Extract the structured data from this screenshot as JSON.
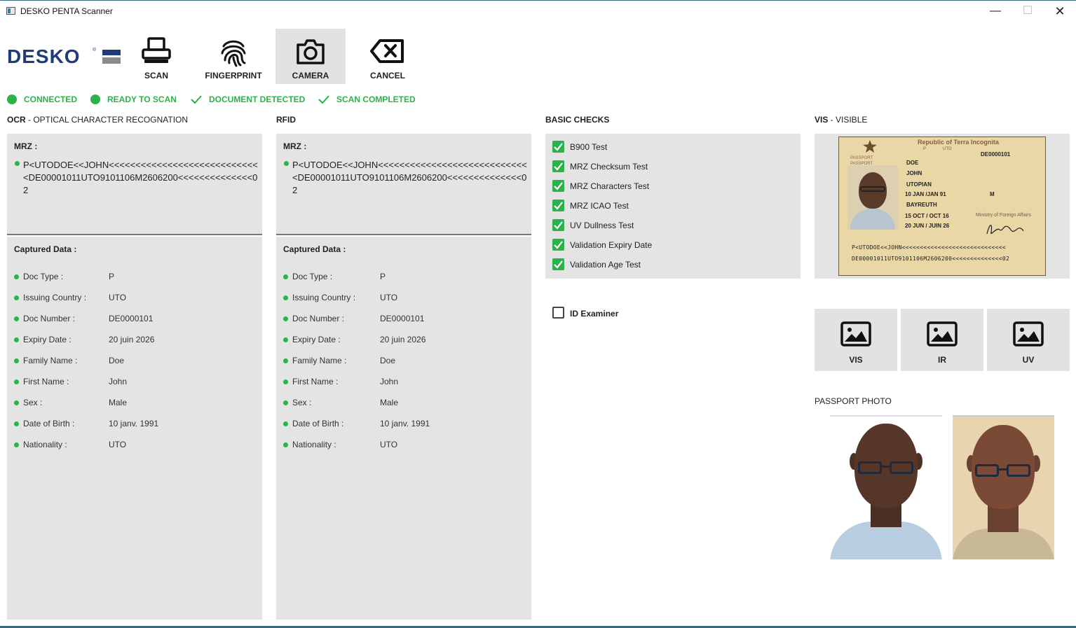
{
  "window": {
    "title": "DESKO PENTA Scanner",
    "min": "—",
    "max": "☐",
    "close": "✕"
  },
  "logo": {
    "text": "DESKO",
    "mark": "®"
  },
  "toolbar": [
    {
      "id": "scan",
      "label": "SCAN",
      "icon": "printer-icon"
    },
    {
      "id": "fingerprint",
      "label": "FINGERPRINT",
      "icon": "fingerprint-icon"
    },
    {
      "id": "camera",
      "label": "CAMERA",
      "icon": "camera-icon",
      "active": true
    },
    {
      "id": "cancel",
      "label": "CANCEL",
      "icon": "backspace-icon"
    }
  ],
  "status": [
    {
      "label": "CONNECTED",
      "icon": "dot"
    },
    {
      "label": "READY TO SCAN",
      "icon": "dot"
    },
    {
      "label": "DOCUMENT DETECTED",
      "icon": "check"
    },
    {
      "label": "SCAN COMPLETED",
      "icon": "check"
    }
  ],
  "status_color": "#2bb24a",
  "ocr": {
    "head_bold": "OCR",
    "head_rest": " - OPTICAL CHARACTER RECOGNATION",
    "mrz_title": "MRZ :",
    "mrz": "P<UTODOE<<JOHN<<<<<<<<<<<<<<<<<<<<<<<<<<<<<DE00001011UTO9101106M2606200<<<<<<<<<<<<<<02",
    "captured_title": "Captured Data :",
    "fields": [
      {
        "label": "Doc Type :",
        "value": "P"
      },
      {
        "label": "Issuing Country :",
        "value": "UTO"
      },
      {
        "label": "Doc Number :",
        "value": "DE0000101"
      },
      {
        "label": "Expiry Date :",
        "value": "20 juin 2026"
      },
      {
        "label": "Family Name :",
        "value": "Doe"
      },
      {
        "label": "First Name :",
        "value": "John"
      },
      {
        "label": "Sex :",
        "value": "Male"
      },
      {
        "label": "Date of Birth :",
        "value": "10 janv. 1991"
      },
      {
        "label": "Nationality :",
        "value": "UTO"
      }
    ]
  },
  "rfid": {
    "head_bold": "RFID",
    "mrz_title": "MRZ :",
    "mrz": "P<UTODOE<<JOHN<<<<<<<<<<<<<<<<<<<<<<<<<<<<<DE00001011UTO9101106M2606200<<<<<<<<<<<<<<02",
    "captured_title": "Captured Data :",
    "fields": [
      {
        "label": "Doc Type :",
        "value": "P"
      },
      {
        "label": "Issuing Country :",
        "value": "UTO"
      },
      {
        "label": "Doc Number :",
        "value": "DE0000101"
      },
      {
        "label": "Expiry Date :",
        "value": "20 juin 2026"
      },
      {
        "label": "Family Name :",
        "value": "Doe"
      },
      {
        "label": "First Name :",
        "value": "John"
      },
      {
        "label": "Sex :",
        "value": "Male"
      },
      {
        "label": "Date of Birth :",
        "value": "10 janv. 1991"
      },
      {
        "label": "Nationality :",
        "value": "UTO"
      }
    ]
  },
  "checks": {
    "head": "BASIC CHECKS",
    "items": [
      {
        "label": "B900 Test",
        "checked": true
      },
      {
        "label": "MRZ Checksum Test",
        "checked": true
      },
      {
        "label": "MRZ Characters Test",
        "checked": true
      },
      {
        "label": "MRZ ICAO Test",
        "checked": true
      },
      {
        "label": "UV Dullness Test",
        "checked": true
      },
      {
        "label": "Validation Expiry Date",
        "checked": true
      },
      {
        "label": "Validation Age Test",
        "checked": true
      }
    ],
    "id_examiner": {
      "label": "ID Examiner",
      "checked": false
    }
  },
  "vis": {
    "head_bold": "VIS",
    "head_rest": " - VISIBLE",
    "passport": {
      "header": "Republic of Terra Incognita",
      "type_line1": "PASSPORT",
      "type_line2": "PASSPORT",
      "type_code": "P",
      "country_code": "UTO",
      "number": "DE0000101",
      "surname": "DOE",
      "given_name": "JOHN",
      "nationality": "UTOPIAN",
      "dob": "10 JAN /JAN 91",
      "sex": "M",
      "place_of_birth": "BAYREUTH",
      "issue_date": "15 OCT / OCT 16",
      "authority": "Ministry of Foreign Affairs",
      "expiry": "20 JUN / JUIN 26",
      "mrz_line1": "P<UTODOE<<JOHN<<<<<<<<<<<<<<<<<<<<<<<<<<<<<",
      "mrz_line2": "DE00001011UTO9101106M2606200<<<<<<<<<<<<<<02"
    },
    "modes": [
      {
        "label": "VIS",
        "icon": "image-icon"
      },
      {
        "label": "IR",
        "icon": "image-icon"
      },
      {
        "label": "UV",
        "icon": "image-icon"
      }
    ]
  },
  "passport_photo": {
    "head": "PASSPORT PHOTO"
  }
}
